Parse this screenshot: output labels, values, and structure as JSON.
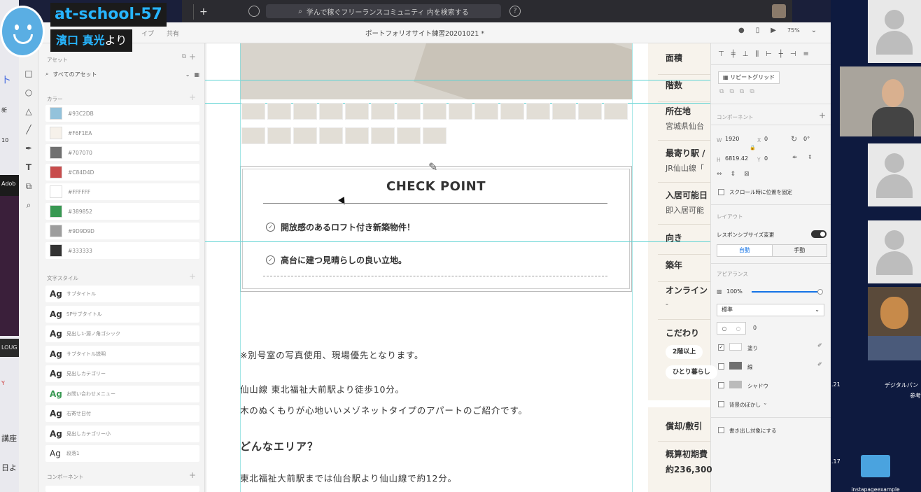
{
  "chat": {
    "room": "at-school-57",
    "sender": "濱口 真光",
    "from_suffix": "より"
  },
  "browser": {
    "search_placeholder": "学んで稼ぐフリーランスコミュニティ 内を検索する",
    "new_tab": "+"
  },
  "xd": {
    "doc_title": "ポートフォリオサイト練習20201021 *",
    "mode_tabs": "イプ　　共有",
    "zoom": "75%",
    "assets": {
      "header": "アセット",
      "search": "すべてのアセット",
      "colors_header": "カラー",
      "colors": [
        {
          "hex": "#93C2DB",
          "label": "#93C2DB"
        },
        {
          "hex": "#F6F1EA",
          "label": "#F6F1EA"
        },
        {
          "hex": "#707070",
          "label": "#707070"
        },
        {
          "hex": "#C84D4D",
          "label": "#C84D4D"
        },
        {
          "hex": "#FFFFFF",
          "label": "#FFFFFF"
        },
        {
          "hex": "#389852",
          "label": "#389852"
        },
        {
          "hex": "#9D9D9D",
          "label": "#9D9D9D"
        },
        {
          "hex": "#333333",
          "label": "#333333"
        }
      ],
      "text_styles_header": "文字スタイル",
      "text_styles": [
        "サブタイトル",
        "SPサブタイトル",
        "見出し1-源ノ角ゴシック",
        "サブタイトル説明",
        "見出しカテゴリー",
        "お問い合わせメニュー",
        "右寄せ日付",
        "見出しカテゴリー小",
        "段落1"
      ],
      "ag": "Ag",
      "components_header": "コンポーネント"
    },
    "canvas": {
      "check_point_title": "CHECK POINT",
      "check_items": [
        "開放感のあるロフト付き新築物件！",
        "高台に建つ見晴らしの良い立地。"
      ],
      "note": "※別号室の写真使用、現場優先となります。",
      "access": "仙山線 東北福祉大前駅より徒歩10分。",
      "intro": "木のぬくもりが心地いいメゾネットタイプのアパートのご紹介です。",
      "area_heading": "どんなエリア？",
      "area_text": "東北福祉大前駅までは仙台駅より仙山線で約12分。",
      "info": [
        {
          "label": "面積",
          "value": ""
        },
        {
          "label": "階数",
          "value": ""
        },
        {
          "label": "所在地",
          "value": "宮城県仙台"
        },
        {
          "label": "最寄り駅 /",
          "value": "JR仙山線「"
        },
        {
          "label": "入居可能日",
          "value": "即入居可能"
        },
        {
          "label": "向き",
          "value": ""
        },
        {
          "label": "築年",
          "value": ""
        },
        {
          "label": "オンライン",
          "value": "-"
        },
        {
          "label": "こだわり",
          "value": ""
        }
      ],
      "tags": [
        "2階以上",
        "ひとり暮らし"
      ],
      "info2": [
        {
          "label": "償却/敷引",
          "value": ""
        },
        {
          "label": "概算初期費",
          "value": "約236,300"
        }
      ]
    },
    "inspector": {
      "repeat_grid": "リピートグリッド",
      "component_header": "コンポーネント",
      "w_label": "W",
      "w_value": "1920",
      "x_label": "X",
      "x_value": "0",
      "rot_value": "0°",
      "h_label": "H",
      "h_value": "6819.42",
      "y_label": "Y",
      "y_value": "0",
      "fix_scroll": "スクロール時に位置を固定",
      "layout_header": "レイアウト",
      "responsive": "レスポンシブサイズ変更",
      "auto": "自動",
      "manual": "手動",
      "appearance_header": "アピアランス",
      "opacity": "100%",
      "blend": "標準",
      "radius": "0",
      "fill": "塗り",
      "border": "線",
      "shadow": "シャドウ",
      "bg_blur": "背景のぼかし",
      "export": "書き出し対象にする"
    }
  },
  "desktop": {
    "label1": "デジタルパン",
    "label1b": "参考",
    "num1": ".21",
    "num2": ".17",
    "folder": "instapageexample"
  },
  "mac_left": {
    "l1": "ト",
    "l2": "新",
    "l3": "10",
    "l4": "Adob",
    "l5": "LOUG",
    "l6": "Y",
    "l7": "講座",
    "l8": "日よ"
  }
}
